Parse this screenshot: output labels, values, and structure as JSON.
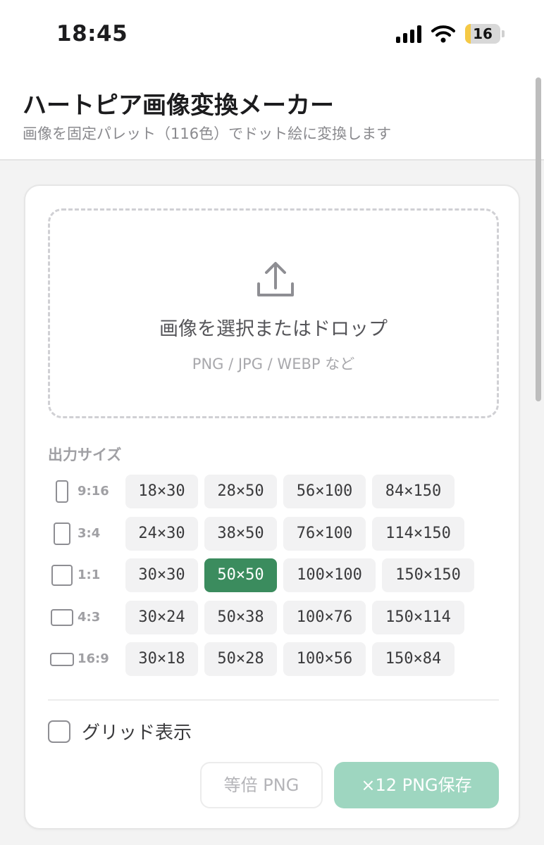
{
  "status_bar": {
    "time": "18:45",
    "battery": "16",
    "battery_level": 0.16
  },
  "header": {
    "title": "ハートピア画像変換メーカー",
    "subtitle": "画像を固定パレット（116色）でドット絵に変換します"
  },
  "dropzone": {
    "label": "画像を選択またはドロップ",
    "formats": "PNG / JPG / WEBP など"
  },
  "output_size": {
    "label": "出力サイズ",
    "rows": [
      {
        "ratio": "9:16",
        "sizes": [
          "18×30",
          "28×50",
          "56×100",
          "84×150"
        ]
      },
      {
        "ratio": "3:4",
        "sizes": [
          "24×30",
          "38×50",
          "76×100",
          "114×150"
        ]
      },
      {
        "ratio": "1:1",
        "sizes": [
          "30×30",
          "50×50",
          "100×100",
          "150×150"
        ]
      },
      {
        "ratio": "4:3",
        "sizes": [
          "30×24",
          "50×38",
          "100×76",
          "150×114"
        ]
      },
      {
        "ratio": "16:9",
        "sizes": [
          "30×18",
          "50×28",
          "100×56",
          "150×84"
        ]
      }
    ],
    "selected": "50×50"
  },
  "grid_toggle": {
    "label": "グリッド表示",
    "checked": false
  },
  "actions": {
    "plain_label": "等倍 PNG",
    "save_label": "×12 PNG保存"
  },
  "colors": {
    "accent": "#3b8c5e",
    "save_button": "#9ed6c0"
  },
  "icons": {
    "upload": "upload-icon",
    "checkbox": "checkbox-icon"
  }
}
